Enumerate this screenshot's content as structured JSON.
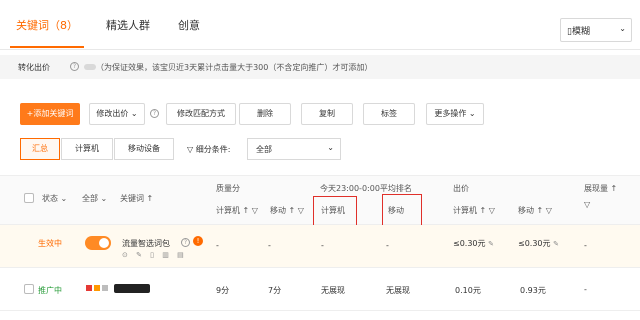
{
  "tabs": [
    {
      "label": "关键词（8）",
      "active": true
    },
    {
      "label": "精选人群",
      "active": false
    },
    {
      "label": "创意",
      "active": false
    }
  ],
  "device_select": {
    "value": "▯模糊"
  },
  "convert": {
    "label": "转化出价",
    "note": "（为保证效果，该宝贝近3天累计点击量大于300（不含定向推广）才可添加）"
  },
  "toolbar": {
    "add": "+添加关键词",
    "modify_bid": "修改出价",
    "modify_match": "修改匹配方式",
    "delete": "删除",
    "copy": "复制",
    "tag": "标签",
    "more": "更多操作"
  },
  "segments": [
    "汇总",
    "计算机",
    "移动设备"
  ],
  "filter": {
    "label": "细分条件:",
    "value": "全部"
  },
  "table": {
    "headers": {
      "status": "状态",
      "all": "全部",
      "keyword": "关键词",
      "quality": "质量分",
      "quality_pc": "计算机",
      "quality_mobile": "移动",
      "rank": "今天23:00-0:00平均排名",
      "rank_pc": "计算机",
      "rank_mobile": "移动",
      "bid": "出价",
      "bid_pc": "计算机",
      "bid_mobile": "移动",
      "impressions": "展现量",
      "sort_arrow": "↑",
      "filter_glyph": "▽"
    },
    "rows": [
      {
        "status": "生效中",
        "keyword": "流量智选词包",
        "quality_pc": "-",
        "quality_mobile": "-",
        "rank_pc": "-",
        "rank_mobile": "-",
        "bid_pc": "≤0.30元",
        "bid_mobile": "≤0.30元",
        "impressions": "-"
      },
      {
        "status": "推广中",
        "keyword": "",
        "quality_pc": "9分",
        "quality_mobile": "7分",
        "rank_pc": "无展现",
        "rank_mobile": "无展现",
        "bid_pc": "0.10元",
        "bid_mobile": "0.93元",
        "impressions": "-"
      }
    ]
  },
  "colors": {
    "accent": "#ff6a00",
    "highlight_box": "#e0302a",
    "promo_status": "#2a9d3b"
  },
  "icons": {
    "help": "help-icon",
    "edit": "edit-icon",
    "chevron": "chevron-down-icon",
    "filter": "filter-icon"
  }
}
